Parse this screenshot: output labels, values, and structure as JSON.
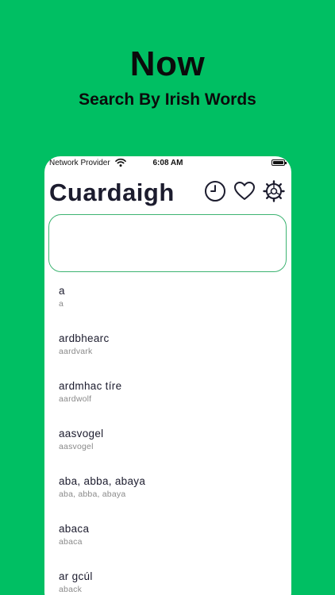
{
  "promo": {
    "headline": "Now",
    "subline": "Search By Irish Words"
  },
  "status_bar": {
    "carrier": "Network Provider",
    "time": "6:08 AM"
  },
  "header": {
    "title": "Cuardaigh"
  },
  "search": {
    "value": "",
    "placeholder": ""
  },
  "words": [
    {
      "irish": "a",
      "english": "a"
    },
    {
      "irish": "ardbhearc",
      "english": "aardvark"
    },
    {
      "irish": "ardmhac tíre",
      "english": "aardwolf"
    },
    {
      "irish": "aasvogel",
      "english": "aasvogel"
    },
    {
      "irish": "aba, abba, abaya",
      "english": "aba, abba, abaya"
    },
    {
      "irish": "abaca",
      "english": "abaca"
    },
    {
      "irish": "ar gcúl",
      "english": "aback"
    }
  ],
  "colors": {
    "background": "#00bf63",
    "input_border": "#3cb371",
    "title": "#1c1c2e"
  },
  "icons": [
    "wifi-icon",
    "battery-icon",
    "history-icon",
    "heart-icon",
    "settings-icon"
  ]
}
